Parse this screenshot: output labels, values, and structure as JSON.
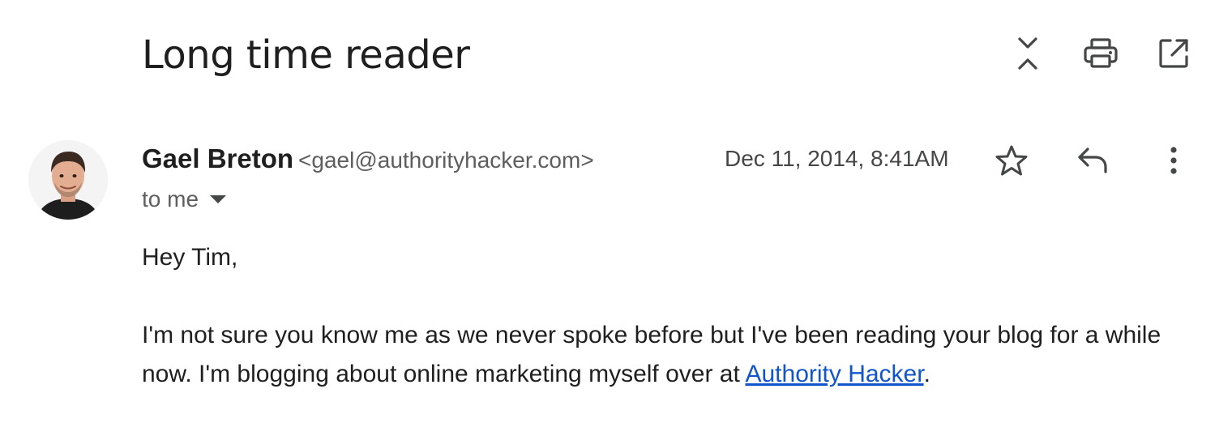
{
  "email": {
    "subject": "Long time reader",
    "sender": {
      "name": "Gael Breton",
      "email": "<gael@authorityhacker.com>"
    },
    "date": "Dec 11, 2014, 8:41AM",
    "recipients": "to me",
    "body": {
      "greeting": "Hey Tim,",
      "paragraph_text": "I'm not sure you know me as we never spoke before but I've been reading your blog for a while now. I'm blogging about online marketing myself over at ",
      "link_text": "Authority Hacker",
      "paragraph_end": "."
    }
  },
  "icons": {
    "toolbar": [
      "collapse-all-icon",
      "print-icon",
      "open-in-new-window-icon"
    ],
    "actions": [
      "star-icon",
      "reply-icon",
      "more-vert-icon"
    ]
  },
  "colors": {
    "text_primary": "#1f1f1f",
    "text_secondary": "#5e5e5e",
    "link": "#1155cc",
    "icon": "#444746"
  }
}
